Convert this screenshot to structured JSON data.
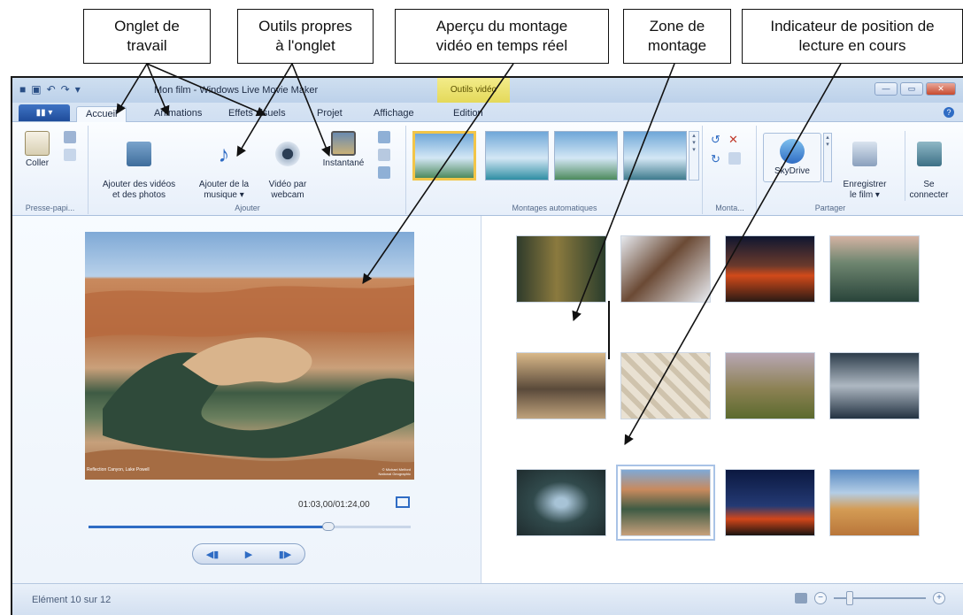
{
  "callouts": [
    {
      "text": "Onglet de\ntravail"
    },
    {
      "text": "Outils propres\nà l'onglet"
    },
    {
      "text": "Aperçu du montage\nvidéo en temps réel"
    },
    {
      "text": "Zone de\nmontage"
    },
    {
      "text": "Indicateur de position de\nlecture en cours"
    }
  ],
  "window": {
    "title": "Mon film - Windows Live Movie Maker",
    "contextual_tools": "Outils vidéo",
    "tabs": [
      {
        "label": "Accueil"
      },
      {
        "label": "Animations"
      },
      {
        "label": "Effets visuels"
      },
      {
        "label": "Projet"
      },
      {
        "label": "Affichage"
      },
      {
        "label": "Edition"
      }
    ]
  },
  "ribbon": {
    "paste_label": "Coller",
    "clipboard_group": "Presse-papi...",
    "add_videos": "Ajouter des vidéos\net des photos",
    "add_music": "Ajouter de la\nmusique ▾",
    "webcam": "Vidéo par\nwebcam",
    "snapshot": "Instantané",
    "add_group": "Ajouter",
    "automovie_group": "Montages automatiques",
    "editing_group": "Monta...",
    "skydrive": "SkyDrive",
    "save_movie": "Enregistrer\nle film ▾",
    "sign_in": "Se\nconnecter",
    "share_group": "Partager"
  },
  "preview": {
    "caption_left": "Reflection Canyon, Lake Powell",
    "caption_right": "© Michael Melford\nNational Geographic",
    "time": "01:03,00/01:24,00"
  },
  "status": {
    "text": "Elément 10 sur 12"
  },
  "colors": {
    "accent": "#2f6cc4",
    "ribbon_bg": "#e7effa",
    "context_tab": "#e4d95a"
  }
}
